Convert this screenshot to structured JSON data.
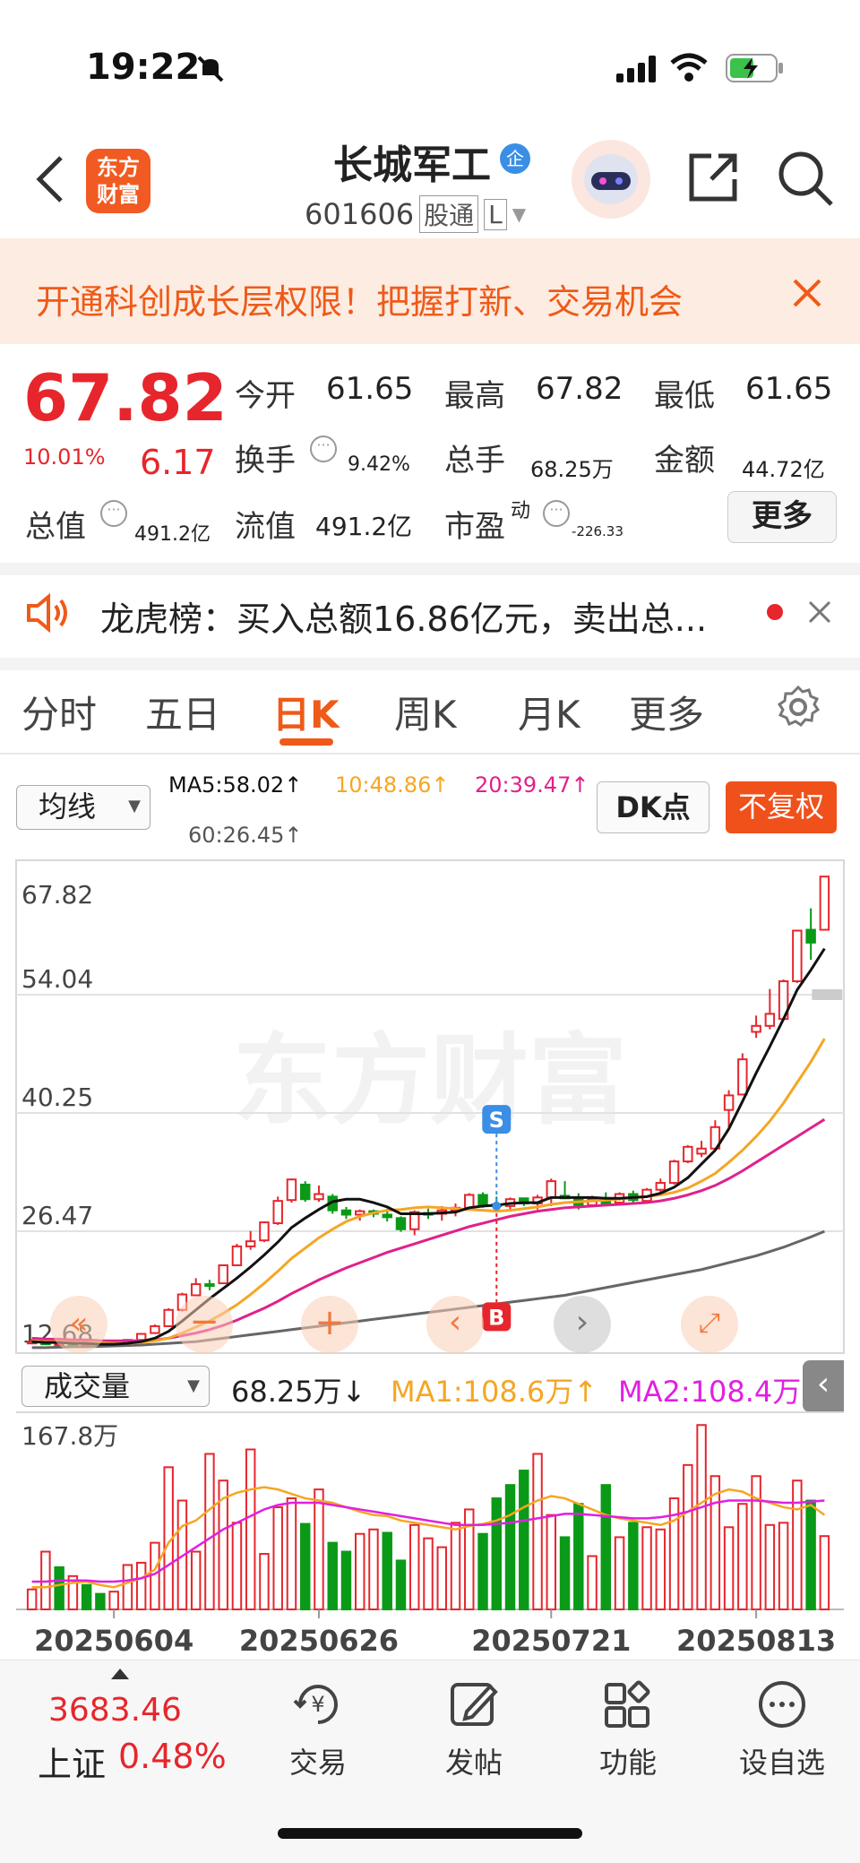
{
  "status_bar": {
    "time": "19:22"
  },
  "header": {
    "logo_line1": "东方",
    "logo_line2": "财富",
    "stock_name": "长城军工",
    "badge": "企",
    "stock_code": "601606",
    "code_tag": "股通",
    "code_tag2": "L"
  },
  "banner": {
    "text": "开通科创成长层权限！把握打新、交易机会"
  },
  "quote": {
    "price": "67.82",
    "change_pct": "10.01%",
    "change_amt": "6.17",
    "open_label": "今开",
    "open": "61.65",
    "high_label": "最高",
    "high": "67.82",
    "low_label": "最低",
    "low": "61.65",
    "turnover_label": "换手",
    "turnover": "9.42%",
    "volume_label": "总手",
    "volume": "68.25万",
    "amount_label": "金额",
    "amount": "44.72亿",
    "mcap_label": "总值",
    "mcap": "491.2亿",
    "float_label": "流值",
    "float_mcap": "491.2亿",
    "pe_label": "市盈",
    "pe_sup": "动",
    "pe": "-226.33",
    "more_label": "更多"
  },
  "dragon_tiger": {
    "text": "龙虎榜：买入总额16.86亿元，卖出总..."
  },
  "tabs": [
    {
      "label": "分时",
      "active": false
    },
    {
      "label": "五日",
      "active": false
    },
    {
      "label": "日K",
      "active": true
    },
    {
      "label": "周K",
      "active": false
    },
    {
      "label": "月K",
      "active": false
    },
    {
      "label": "更多",
      "active": false
    }
  ],
  "ma_legend": {
    "selector": "均线",
    "ma5": "MA5:58.02↑",
    "ma10": "10:48.86↑",
    "ma20": "20:39.47↑",
    "ma60": "60:26.45↑",
    "dk_label": "DK点",
    "fq_label": "不复权",
    "colors": {
      "ma5": "#111111",
      "ma10": "#f5a623",
      "ma20": "#e0208c",
      "ma60": "#666666"
    }
  },
  "volume_legend": {
    "selector": "成交量",
    "vol": "68.25万↓",
    "ma1": "MA1:108.6万↑",
    "ma2": "MA2:108.4万",
    "colors": {
      "ma1": "#f5a623",
      "ma2": "#e020e0"
    }
  },
  "chart_data": {
    "type": "candlestick",
    "price_ticks": [
      "67.82",
      "54.04",
      "40.25",
      "26.47",
      "12.68"
    ],
    "ylim": [
      12.68,
      67.82
    ],
    "volume_max_label": "167.8万",
    "volume_ylim": [
      0,
      167.8
    ],
    "volume_unit": "万",
    "date_labels": [
      "20250604",
      "20250626",
      "20250721",
      "20250813"
    ],
    "watermark": "东方财富",
    "markers": [
      {
        "label": "S",
        "candle_index": 34,
        "color": "#3a8ee6"
      },
      {
        "label": "B",
        "candle_index": 34,
        "color": "#e6262c"
      }
    ],
    "candles": [
      {
        "o": 13.6,
        "h": 13.9,
        "l": 13.3,
        "c": 13.6
      },
      {
        "o": 13.5,
        "h": 13.7,
        "l": 13.2,
        "c": 13.3
      },
      {
        "o": 13.3,
        "h": 13.6,
        "l": 13.1,
        "c": 13.4
      },
      {
        "o": 13.4,
        "h": 13.6,
        "l": 13.1,
        "c": 13.2
      },
      {
        "o": 13.2,
        "h": 13.5,
        "l": 13.0,
        "c": 13.3
      },
      {
        "o": 13.3,
        "h": 13.5,
        "l": 13.1,
        "c": 13.2
      },
      {
        "o": 13.2,
        "h": 13.5,
        "l": 13.0,
        "c": 13.4
      },
      {
        "o": 13.4,
        "h": 13.9,
        "l": 13.3,
        "c": 13.8
      },
      {
        "o": 13.8,
        "h": 14.6,
        "l": 13.7,
        "c": 14.5
      },
      {
        "o": 14.6,
        "h": 15.6,
        "l": 14.5,
        "c": 15.4
      },
      {
        "o": 15.4,
        "h": 17.5,
        "l": 15.3,
        "c": 17.3
      },
      {
        "o": 17.3,
        "h": 19.3,
        "l": 17.1,
        "c": 19.1
      },
      {
        "o": 19.0,
        "h": 21.0,
        "l": 18.9,
        "c": 20.3
      },
      {
        "o": 20.3,
        "h": 20.8,
        "l": 19.6,
        "c": 20.2
      },
      {
        "o": 20.4,
        "h": 22.6,
        "l": 20.3,
        "c": 22.5
      },
      {
        "o": 22.5,
        "h": 25.0,
        "l": 22.4,
        "c": 24.7
      },
      {
        "o": 24.7,
        "h": 26.5,
        "l": 24.3,
        "c": 25.3
      },
      {
        "o": 25.4,
        "h": 27.6,
        "l": 25.2,
        "c": 27.5
      },
      {
        "o": 27.4,
        "h": 30.5,
        "l": 27.2,
        "c": 30.0
      },
      {
        "o": 30.1,
        "h": 32.6,
        "l": 29.8,
        "c": 32.5
      },
      {
        "o": 31.9,
        "h": 32.3,
        "l": 29.9,
        "c": 30.2
      },
      {
        "o": 30.2,
        "h": 31.8,
        "l": 29.9,
        "c": 30.8
      },
      {
        "o": 30.5,
        "h": 30.8,
        "l": 28.5,
        "c": 28.9
      },
      {
        "o": 28.9,
        "h": 29.3,
        "l": 27.9,
        "c": 28.4
      },
      {
        "o": 28.4,
        "h": 29.0,
        "l": 27.7,
        "c": 28.8
      },
      {
        "o": 28.8,
        "h": 29.0,
        "l": 28.1,
        "c": 28.5
      },
      {
        "o": 28.4,
        "h": 29.1,
        "l": 27.6,
        "c": 28.1
      },
      {
        "o": 28.0,
        "h": 28.2,
        "l": 26.4,
        "c": 26.7
      },
      {
        "o": 26.7,
        "h": 28.9,
        "l": 26.0,
        "c": 28.7
      },
      {
        "o": 28.6,
        "h": 29.1,
        "l": 27.9,
        "c": 28.5
      },
      {
        "o": 28.5,
        "h": 29.4,
        "l": 27.7,
        "c": 28.9
      },
      {
        "o": 28.9,
        "h": 29.7,
        "l": 28.2,
        "c": 29.2
      },
      {
        "o": 29.2,
        "h": 30.9,
        "l": 28.9,
        "c": 30.7
      },
      {
        "o": 30.7,
        "h": 31.0,
        "l": 29.2,
        "c": 29.6
      },
      {
        "o": 29.6,
        "h": 30.5,
        "l": 28.8,
        "c": 29.4
      },
      {
        "o": 29.4,
        "h": 30.4,
        "l": 29.0,
        "c": 30.2
      },
      {
        "o": 30.3,
        "h": 30.4,
        "l": 29.4,
        "c": 29.7
      },
      {
        "o": 29.7,
        "h": 30.7,
        "l": 29.0,
        "c": 30.4
      },
      {
        "o": 30.4,
        "h": 32.6,
        "l": 29.4,
        "c": 32.3
      },
      {
        "o": 30.6,
        "h": 32.3,
        "l": 30.2,
        "c": 30.3
      },
      {
        "o": 30.3,
        "h": 30.9,
        "l": 29.0,
        "c": 29.5
      },
      {
        "o": 29.5,
        "h": 30.6,
        "l": 29.3,
        "c": 30.2
      },
      {
        "o": 30.2,
        "h": 31.0,
        "l": 29.5,
        "c": 29.7
      },
      {
        "o": 29.8,
        "h": 31.0,
        "l": 29.7,
        "c": 30.8
      },
      {
        "o": 30.8,
        "h": 31.2,
        "l": 29.8,
        "c": 30.1
      },
      {
        "o": 30.0,
        "h": 31.5,
        "l": 29.9,
        "c": 31.3
      },
      {
        "o": 31.3,
        "h": 32.6,
        "l": 30.9,
        "c": 32.1
      },
      {
        "o": 32.1,
        "h": 34.8,
        "l": 31.9,
        "c": 34.6
      },
      {
        "o": 34.6,
        "h": 36.5,
        "l": 34.4,
        "c": 36.3
      },
      {
        "o": 35.5,
        "h": 37.0,
        "l": 35.1,
        "c": 36.1
      },
      {
        "o": 36.1,
        "h": 39.4,
        "l": 35.9,
        "c": 38.6
      },
      {
        "o": 40.6,
        "h": 42.9,
        "l": 38.6,
        "c": 42.3
      },
      {
        "o": 42.4,
        "h": 47.2,
        "l": 42.3,
        "c": 46.5
      },
      {
        "o": 49.7,
        "h": 51.6,
        "l": 49.0,
        "c": 50.4
      },
      {
        "o": 50.4,
        "h": 54.7,
        "l": 50.0,
        "c": 51.8
      },
      {
        "o": 51.2,
        "h": 55.8,
        "l": 51.0,
        "c": 55.6
      },
      {
        "o": 55.6,
        "h": 61.6,
        "l": 55.4,
        "c": 61.5
      },
      {
        "o": 61.6,
        "h": 64.1,
        "l": 58.1,
        "c": 60.1
      },
      {
        "o": 61.6,
        "h": 67.8,
        "l": 61.6,
        "c": 67.8
      }
    ],
    "ma5": [
      13.6,
      13.5,
      13.5,
      13.4,
      13.4,
      13.3,
      13.3,
      13.4,
      13.6,
      14.0,
      14.8,
      16.0,
      17.3,
      18.6,
      19.8,
      21.0,
      22.3,
      23.7,
      25.2,
      26.9,
      28.0,
      29.0,
      29.9,
      30.2,
      30.2,
      29.8,
      29.3,
      28.5,
      28.5,
      28.5,
      28.6,
      28.7,
      29.2,
      29.4,
      29.5,
      29.7,
      29.8,
      29.8,
      30.4,
      30.4,
      30.4,
      30.4,
      30.3,
      30.3,
      30.4,
      30.5,
      30.9,
      31.6,
      32.7,
      34.3,
      35.9,
      38.4,
      41.6,
      44.9,
      48.0,
      51.2,
      54.6,
      56.9,
      59.4
    ],
    "ma10": [
      13.7,
      13.6,
      13.6,
      13.5,
      13.5,
      13.5,
      13.4,
      13.4,
      13.5,
      13.7,
      14.0,
      14.6,
      15.3,
      16.0,
      16.9,
      17.9,
      19.1,
      20.4,
      21.8,
      23.3,
      24.5,
      25.7,
      26.7,
      27.6,
      28.2,
      28.6,
      28.9,
      29.0,
      29.2,
      29.3,
      29.2,
      29.1,
      29.0,
      28.9,
      28.8,
      28.9,
      29.1,
      29.3,
      29.6,
      29.8,
      29.9,
      30.0,
      30.1,
      30.2,
      30.4,
      30.5,
      30.7,
      31.0,
      31.5,
      32.3,
      33.2,
      34.5,
      35.9,
      37.5,
      39.3,
      41.4,
      43.8,
      46.2,
      48.9
    ],
    "ma20": [
      14.0,
      13.9,
      13.9,
      13.8,
      13.8,
      13.7,
      13.7,
      13.7,
      13.7,
      13.8,
      14.0,
      14.3,
      14.6,
      15.0,
      15.5,
      16.1,
      16.8,
      17.5,
      18.3,
      19.2,
      20.0,
      20.8,
      21.5,
      22.2,
      22.8,
      23.4,
      24.0,
      24.5,
      25.0,
      25.5,
      26.0,
      26.5,
      27.0,
      27.4,
      27.8,
      28.2,
      28.5,
      28.8,
      29.0,
      29.2,
      29.3,
      29.4,
      29.5,
      29.6,
      29.7,
      29.8,
      30.0,
      30.3,
      30.7,
      31.2,
      31.8,
      32.6,
      33.5,
      34.5,
      35.5,
      36.5,
      37.5,
      38.5,
      39.5
    ],
    "ma60": [
      12.9,
      12.9,
      12.95,
      13.0,
      13.0,
      13.05,
      13.1,
      13.15,
      13.2,
      13.3,
      13.4,
      13.5,
      13.6,
      13.8,
      14.0,
      14.2,
      14.4,
      14.6,
      14.8,
      15.0,
      15.2,
      15.4,
      15.6,
      15.8,
      16.0,
      16.2,
      16.4,
      16.6,
      16.8,
      17.0,
      17.2,
      17.4,
      17.6,
      17.8,
      18.0,
      18.2,
      18.4,
      18.6,
      18.8,
      19.0,
      19.3,
      19.6,
      19.9,
      20.2,
      20.5,
      20.8,
      21.1,
      21.4,
      21.7,
      22.0,
      22.4,
      22.8,
      23.2,
      23.6,
      24.1,
      24.6,
      25.2,
      25.8,
      26.45
    ],
    "volume": [
      18,
      52,
      38,
      30,
      22,
      14,
      16,
      40,
      42,
      60,
      128,
      98,
      52,
      140,
      116,
      78,
      144,
      50,
      92,
      100,
      77,
      108,
      60,
      52,
      68,
      72,
      69,
      44,
      76,
      64,
      56,
      78,
      90,
      68,
      100,
      112,
      125,
      140,
      85,
      65,
      95,
      48,
      112,
      65,
      78,
      74,
      72,
      100,
      130,
      166,
      120,
      74,
      95,
      120,
      76,
      78,
      116,
      98,
      66
    ],
    "vol_ma1": [
      20,
      20,
      22,
      24,
      25,
      22,
      20,
      24,
      28,
      36,
      60,
      75,
      80,
      90,
      100,
      105,
      108,
      110,
      108,
      104,
      100,
      98,
      96,
      92,
      88,
      85,
      84,
      80,
      78,
      76,
      74,
      72,
      75,
      77,
      80,
      85,
      92,
      98,
      102,
      100,
      95,
      90,
      85,
      82,
      80,
      78,
      76,
      80,
      88,
      96,
      104,
      108,
      106,
      100,
      96,
      92,
      90,
      94,
      85
    ],
    "vol_ma2": [
      25,
      25,
      26,
      26,
      26,
      25,
      25,
      26,
      28,
      32,
      40,
      48,
      56,
      64,
      72,
      78,
      84,
      90,
      94,
      96,
      96,
      96,
      94,
      92,
      90,
      88,
      86,
      84,
      82,
      80,
      78,
      76,
      76,
      76,
      77,
      78,
      80,
      82,
      84,
      86,
      86,
      85,
      84,
      83,
      82,
      82,
      83,
      85,
      88,
      92,
      96,
      98,
      98,
      98,
      97,
      96,
      96,
      97,
      98
    ],
    "vol_up": [
      true,
      true,
      false,
      true,
      false,
      false,
      true,
      true,
      true,
      true,
      true,
      true,
      true,
      true,
      true,
      true,
      true,
      true,
      true,
      true,
      false,
      true,
      false,
      false,
      true,
      true,
      false,
      false,
      true,
      true,
      true,
      true,
      true,
      false,
      false,
      false,
      false,
      true,
      true,
      false,
      false,
      true,
      false,
      true,
      false,
      true,
      true,
      true,
      true,
      true,
      true,
      true,
      true,
      true,
      true,
      true,
      true,
      false,
      true
    ]
  },
  "bottom_nav": {
    "index_value": "3683.46",
    "index_name": "上证",
    "index_change": "0.48%",
    "items": [
      {
        "label": "交易",
        "icon": "trade-icon"
      },
      {
        "label": "发帖",
        "icon": "post-icon"
      },
      {
        "label": "功能",
        "icon": "grid-icon"
      },
      {
        "label": "设自选",
        "icon": "more-dots-icon"
      }
    ]
  }
}
